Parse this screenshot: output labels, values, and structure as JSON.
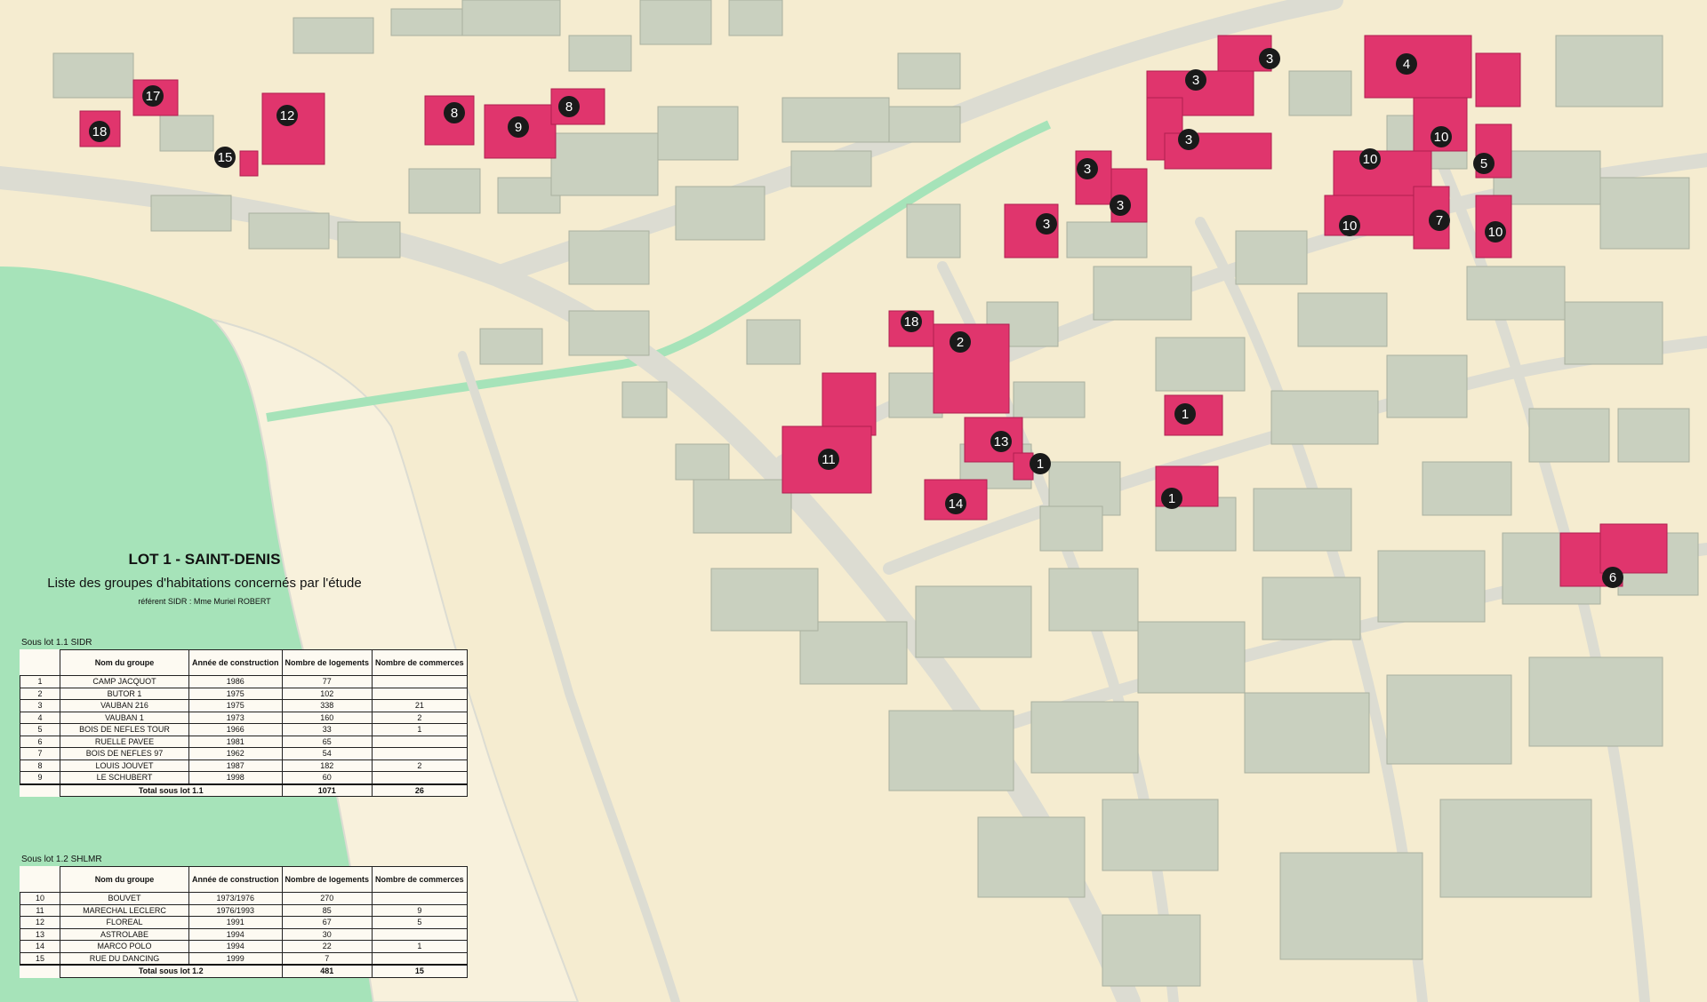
{
  "title": "LOT 1 - SAINT-DENIS",
  "subtitle": "Liste des groupes d'habitations concernés par l'étude",
  "referent": "référent SIDR : Mme Muriel ROBERT",
  "colors": {
    "ocean": "#a6e3b9",
    "land": "#f5ecd0",
    "road": "#dcdcd2",
    "building": "#c9d0bf",
    "highlight": "#e0356d",
    "marker": "#1a1a1a"
  },
  "tables": {
    "headers": {
      "name": "Nom du groupe",
      "year": "Année de construction",
      "logements": "Nombre de logements",
      "commerces": "Nombre de commerces"
    },
    "sidr": {
      "label": "Sous lot 1.1 SIDR",
      "rows": [
        {
          "num": "1",
          "name": "CAMP JACQUOT",
          "year": "1986",
          "logements": "77",
          "commerces": ""
        },
        {
          "num": "2",
          "name": "BUTOR 1",
          "year": "1975",
          "logements": "102",
          "commerces": ""
        },
        {
          "num": "3",
          "name": "VAUBAN 216",
          "year": "1975",
          "logements": "338",
          "commerces": "21"
        },
        {
          "num": "4",
          "name": "VAUBAN 1",
          "year": "1973",
          "logements": "160",
          "commerces": "2"
        },
        {
          "num": "5",
          "name": "BOIS DE NEFLES TOUR",
          "year": "1966",
          "logements": "33",
          "commerces": "1"
        },
        {
          "num": "6",
          "name": "RUELLE PAVEE",
          "year": "1981",
          "logements": "65",
          "commerces": ""
        },
        {
          "num": "7",
          "name": "BOIS DE NEFLES 97",
          "year": "1962",
          "logements": "54",
          "commerces": ""
        },
        {
          "num": "8",
          "name": "LOUIS JOUVET",
          "year": "1987",
          "logements": "182",
          "commerces": "2"
        },
        {
          "num": "9",
          "name": "LE SCHUBERT",
          "year": "1998",
          "logements": "60",
          "commerces": ""
        }
      ],
      "total": {
        "label": "Total sous lot 1.1",
        "logements": "1071",
        "commerces": "26"
      }
    },
    "shlmr": {
      "label": "Sous lot 1.2 SHLMR",
      "rows": [
        {
          "num": "10",
          "name": "BOUVET",
          "year": "1973/1976",
          "logements": "270",
          "commerces": ""
        },
        {
          "num": "11",
          "name": "MARECHAL LECLERC",
          "year": "1976/1993",
          "logements": "85",
          "commerces": "9"
        },
        {
          "num": "12",
          "name": "FLOREAL",
          "year": "1991",
          "logements": "67",
          "commerces": "5"
        },
        {
          "num": "13",
          "name": "ASTROLABE",
          "year": "1994",
          "logements": "30",
          "commerces": ""
        },
        {
          "num": "14",
          "name": "MARCO POLO",
          "year": "1994",
          "logements": "22",
          "commerces": "1"
        },
        {
          "num": "15",
          "name": "RUE DU DANCING",
          "year": "1999",
          "logements": "7",
          "commerces": ""
        }
      ],
      "total": {
        "label": "Total sous lot 1.2",
        "logements": "481",
        "commerces": "15"
      }
    }
  },
  "markers": [
    "18",
    "17",
    "15",
    "12",
    "8",
    "9",
    "8",
    "3",
    "3",
    "3",
    "3",
    "3",
    "3",
    "4",
    "10",
    "10",
    "10",
    "5",
    "7",
    "10",
    "18",
    "2",
    "1",
    "13",
    "11",
    "1",
    "14",
    "1",
    "6"
  ]
}
